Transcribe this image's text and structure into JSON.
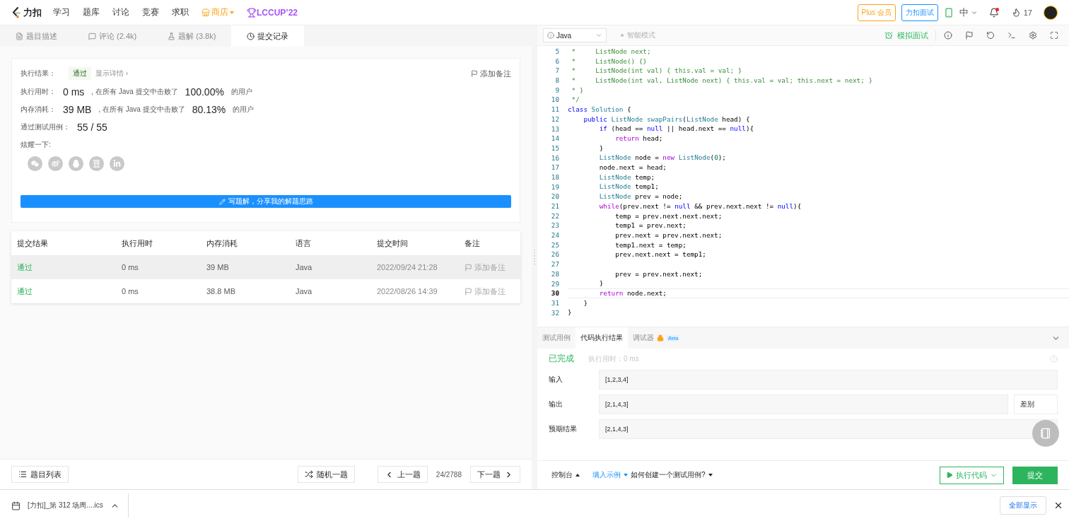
{
  "nav": {
    "logo": "力扣",
    "items": [
      {
        "label": "学习"
      },
      {
        "label": "题库"
      },
      {
        "label": "讨论"
      },
      {
        "label": "竞赛"
      },
      {
        "label": "求职"
      }
    ],
    "store": "商店",
    "contest": "LCCUP’22",
    "plus": "Plus 会员",
    "interview": "力扣面试",
    "language": "中",
    "has_notification": true,
    "streak": "17"
  },
  "left_tabs": [
    {
      "label": "题目描述",
      "kind": "description",
      "selected": false
    },
    {
      "label": "评论 (2.4k)",
      "kind": "comments",
      "selected": false
    },
    {
      "label": "题解 (3.8k)",
      "kind": "solutions",
      "selected": false
    },
    {
      "label": "提交记录",
      "kind": "submissions",
      "selected": true
    }
  ],
  "result": {
    "status_label": "执行结果：",
    "status": "通过",
    "details": "显示详情 ›",
    "add_note": "添加备注",
    "stats": [
      {
        "label": "执行用时：",
        "value": "0 ms",
        "middle": ", 在所有 Java 提交中击败了",
        "percent": "100.00%",
        "suffix": "的用户"
      },
      {
        "label": "内存消耗：",
        "value": "39 MB",
        "middle": ", 在所有 Java 提交中击败了",
        "percent": "80.13%",
        "suffix": "的用户"
      }
    ],
    "cases_label": "通过测试用例：",
    "cases": "55 / 55",
    "share_label": "炫耀一下:",
    "share": [
      {
        "kind": "wechat"
      },
      {
        "kind": "weibo"
      },
      {
        "kind": "qq"
      },
      {
        "kind": "douban"
      },
      {
        "kind": "linkedin"
      }
    ],
    "write_button": "写题解，分享我的解题思路"
  },
  "table": {
    "columns": [
      "提交结果",
      "执行用时",
      "内存消耗",
      "语言",
      "提交时间",
      "备注"
    ],
    "rows": [
      {
        "status": "通过",
        "runtime": "0 ms",
        "memory": "39 MB",
        "language": "Java",
        "time": "2022/09/24 21:28",
        "note": "添加备注",
        "hovered": true
      },
      {
        "status": "通过",
        "runtime": "0 ms",
        "memory": "38.8 MB",
        "language": "Java",
        "time": "2022/08/26 14:39",
        "note": "添加备注",
        "hovered": false
      }
    ]
  },
  "bottom_nav": {
    "list": "题目列表",
    "random": "随机一题",
    "prev": "上一题",
    "position": "24/2788",
    "next": "下一题"
  },
  "editor": {
    "language": "Java",
    "mode": "智能模式",
    "mock": "模拟面试",
    "lines": [
      {
        "number": "5",
        "active": false,
        "tokens": [
          {
            "text": " *     ListNode next;",
            "kind": "comment"
          }
        ]
      },
      {
        "number": "6",
        "active": false,
        "tokens": [
          {
            "text": " *     ListNode() {}",
            "kind": "comment"
          }
        ]
      },
      {
        "number": "7",
        "active": false,
        "tokens": [
          {
            "text": " *     ListNode(int val) { this.val = val; }",
            "kind": "comment"
          }
        ]
      },
      {
        "number": "8",
        "active": false,
        "tokens": [
          {
            "text": " *     ListNode(int val, ListNode next) { this.val = val; this.next = next; }",
            "kind": "comment"
          }
        ]
      },
      {
        "number": "9",
        "active": false,
        "tokens": [
          {
            "text": " * }",
            "kind": "comment"
          }
        ]
      },
      {
        "number": "10",
        "active": false,
        "tokens": [
          {
            "text": " */",
            "kind": "comment"
          }
        ]
      },
      {
        "number": "11",
        "active": false,
        "tokens": [
          {
            "text": "class",
            "kind": "keyword"
          },
          {
            "text": " Solution",
            "kind": "type"
          },
          {
            "text": " {",
            "kind": "plain"
          }
        ]
      },
      {
        "number": "12",
        "active": false,
        "tokens": [
          {
            "text": "    public",
            "kind": "keyword"
          },
          {
            "text": " ListNode",
            "kind": "type"
          },
          {
            "text": " swapPairs",
            "kind": "function"
          },
          {
            "text": "(",
            "kind": "plain"
          },
          {
            "text": "ListNode",
            "kind": "type"
          },
          {
            "text": " head) {",
            "kind": "plain"
          }
        ]
      },
      {
        "number": "13",
        "active": false,
        "tokens": [
          {
            "text": "        if",
            "kind": "keyword"
          },
          {
            "text": " (head == ",
            "kind": "plain"
          },
          {
            "text": "null",
            "kind": "keyword"
          },
          {
            "text": " || head.next == ",
            "kind": "plain"
          },
          {
            "text": "null",
            "kind": "keyword"
          },
          {
            "text": "){",
            "kind": "plain"
          }
        ]
      },
      {
        "number": "14",
        "active": false,
        "tokens": [
          {
            "text": "            return",
            "kind": "control"
          },
          {
            "text": " head;",
            "kind": "plain"
          }
        ]
      },
      {
        "number": "15",
        "active": false,
        "tokens": [
          {
            "text": "        }",
            "kind": "plain"
          }
        ]
      },
      {
        "number": "16",
        "active": false,
        "tokens": [
          {
            "text": "        ListNode",
            "kind": "type"
          },
          {
            "text": " node = ",
            "kind": "plain"
          },
          {
            "text": "new",
            "kind": "control"
          },
          {
            "text": " ListNode",
            "kind": "type"
          },
          {
            "text": "(",
            "kind": "plain"
          },
          {
            "text": "0",
            "kind": "number"
          },
          {
            "text": ");",
            "kind": "plain"
          }
        ]
      },
      {
        "number": "17",
        "active": false,
        "tokens": [
          {
            "text": "        node.next = head;",
            "kind": "plain"
          }
        ]
      },
      {
        "number": "18",
        "active": false,
        "tokens": [
          {
            "text": "        ListNode",
            "kind": "type"
          },
          {
            "text": " temp;",
            "kind": "plain"
          }
        ]
      },
      {
        "number": "19",
        "active": false,
        "tokens": [
          {
            "text": "        ListNode",
            "kind": "type"
          },
          {
            "text": " temp1;",
            "kind": "plain"
          }
        ]
      },
      {
        "number": "20",
        "active": false,
        "tokens": [
          {
            "text": "        ListNode",
            "kind": "type"
          },
          {
            "text": " prev = node;",
            "kind": "plain"
          }
        ]
      },
      {
        "number": "21",
        "active": false,
        "tokens": [
          {
            "text": "        while",
            "kind": "control"
          },
          {
            "text": "(prev.next != ",
            "kind": "plain"
          },
          {
            "text": "null",
            "kind": "keyword"
          },
          {
            "text": " && prev.next.next != ",
            "kind": "plain"
          },
          {
            "text": "null",
            "kind": "keyword"
          },
          {
            "text": "){",
            "kind": "plain"
          }
        ]
      },
      {
        "number": "22",
        "active": false,
        "tokens": [
          {
            "text": "            temp = prev.next.next.next;",
            "kind": "plain"
          }
        ]
      },
      {
        "number": "23",
        "active": false,
        "tokens": [
          {
            "text": "            temp1 = prev.next;",
            "kind": "plain"
          }
        ]
      },
      {
        "number": "24",
        "active": false,
        "tokens": [
          {
            "text": "            prev.next = prev.next.next;",
            "kind": "plain"
          }
        ]
      },
      {
        "number": "25",
        "active": false,
        "tokens": [
          {
            "text": "            temp1.next = temp;",
            "kind": "plain"
          }
        ]
      },
      {
        "number": "26",
        "active": false,
        "tokens": [
          {
            "text": "            prev.next.next = temp1;",
            "kind": "plain"
          }
        ]
      },
      {
        "number": "27",
        "active": false
      },
      {
        "number": "28",
        "active": false,
        "tokens": [
          {
            "text": "            prev = prev.next.next;",
            "kind": "plain"
          }
        ]
      },
      {
        "number": "29",
        "active": false,
        "tokens": [
          {
            "text": "        }",
            "kind": "plain"
          }
        ]
      },
      {
        "number": "30",
        "active": true,
        "tokens": [
          {
            "text": "        return",
            "kind": "control"
          },
          {
            "text": " node.next;",
            "kind": "plain"
          }
        ]
      },
      {
        "number": "31",
        "active": false,
        "tokens": [
          {
            "text": "    }",
            "kind": "plain"
          }
        ]
      },
      {
        "number": "32",
        "active": false,
        "tokens": [
          {
            "text": "}",
            "kind": "plain"
          }
        ]
      }
    ]
  },
  "console": {
    "tabs": [
      {
        "label": "测试用例",
        "selected": false
      },
      {
        "label": "代码执行结果",
        "selected": true
      },
      {
        "label": "调试器",
        "selected": false,
        "locked": true,
        "badge": "Beta"
      }
    ],
    "status": "已完成",
    "runtime": "执行用时：0 ms",
    "fields": [
      {
        "label": "输入",
        "value": "[1,2,3,4]"
      },
      {
        "label": "输出",
        "value": "[2,1,4,3]",
        "diff": "差别"
      },
      {
        "label": "预期结果",
        "value": "[2,1,4,3]"
      }
    ],
    "console": "控制台",
    "fill_example": "填入示例",
    "how_to": "如何创建一个测试用例?",
    "run": "执行代码",
    "submit": "提交"
  },
  "downloads": {
    "file": "[力扣]_第 312 场周....ics",
    "show_all": "全部显示"
  }
}
